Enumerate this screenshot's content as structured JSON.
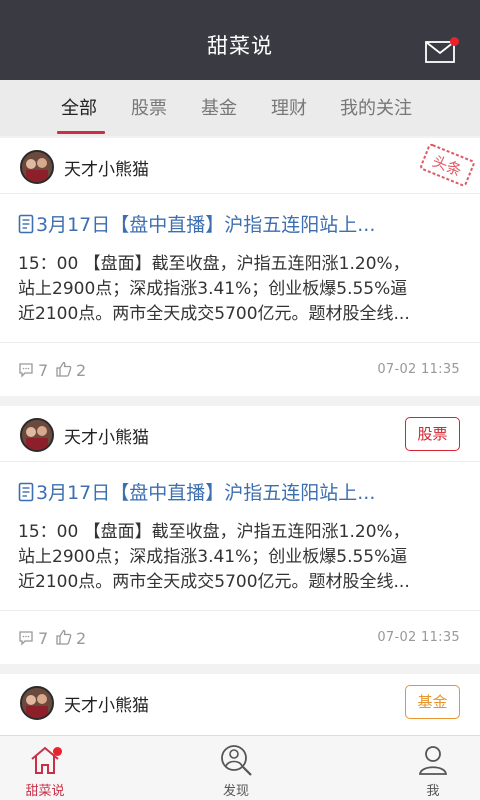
{
  "header": {
    "title": "甜菜说",
    "mail_icon": "mail-icon",
    "has_unread": true
  },
  "tabs": [
    {
      "label": "全部",
      "active": true
    },
    {
      "label": "股票",
      "active": false
    },
    {
      "label": "基金",
      "active": false
    },
    {
      "label": "理财",
      "active": false
    },
    {
      "label": "我的关注",
      "active": false
    }
  ],
  "posts": [
    {
      "author": "天才小熊猫",
      "stamp": "头条",
      "title": "3月17日【盘中直播】沪指五连阳站上...",
      "lines": [
        "15：00 【盘面】截至收盘，沪指五连阳涨1.20%，",
        "站上2900点；深成指涨3.41%；创业板爆5.55%逼",
        "近2100点。两市全天成交5700亿元。题材股全线..."
      ],
      "comments": "7",
      "likes": "2",
      "time": "07-02  11:35"
    },
    {
      "author": "天才小熊猫",
      "tag": "股票",
      "tag_color": "#d5232f",
      "title": "3月17日【盘中直播】沪指五连阳站上...",
      "lines": [
        "15：00 【盘面】截至收盘，沪指五连阳涨1.20%，",
        "站上2900点；深成指涨3.41%；创业板爆5.55%逼",
        "近2100点。两市全天成交5700亿元。题材股全线..."
      ],
      "comments": "7",
      "likes": "2",
      "time": "07-02  11:35"
    },
    {
      "author": "天才小熊猫",
      "tag": "基金",
      "tag_color": "#e7962f"
    }
  ],
  "bottom_nav": [
    {
      "label": "甜菜说",
      "icon": "home-icon",
      "active": true
    },
    {
      "label": "发现",
      "icon": "discover-icon",
      "active": false
    },
    {
      "label": "我",
      "icon": "profile-icon",
      "active": false
    }
  ],
  "colors": {
    "header_bg": "#3a3b42",
    "accent": "#c93048",
    "link": "#3d6fb0",
    "tag_red": "#d5232f",
    "tag_orange": "#e7962f"
  }
}
